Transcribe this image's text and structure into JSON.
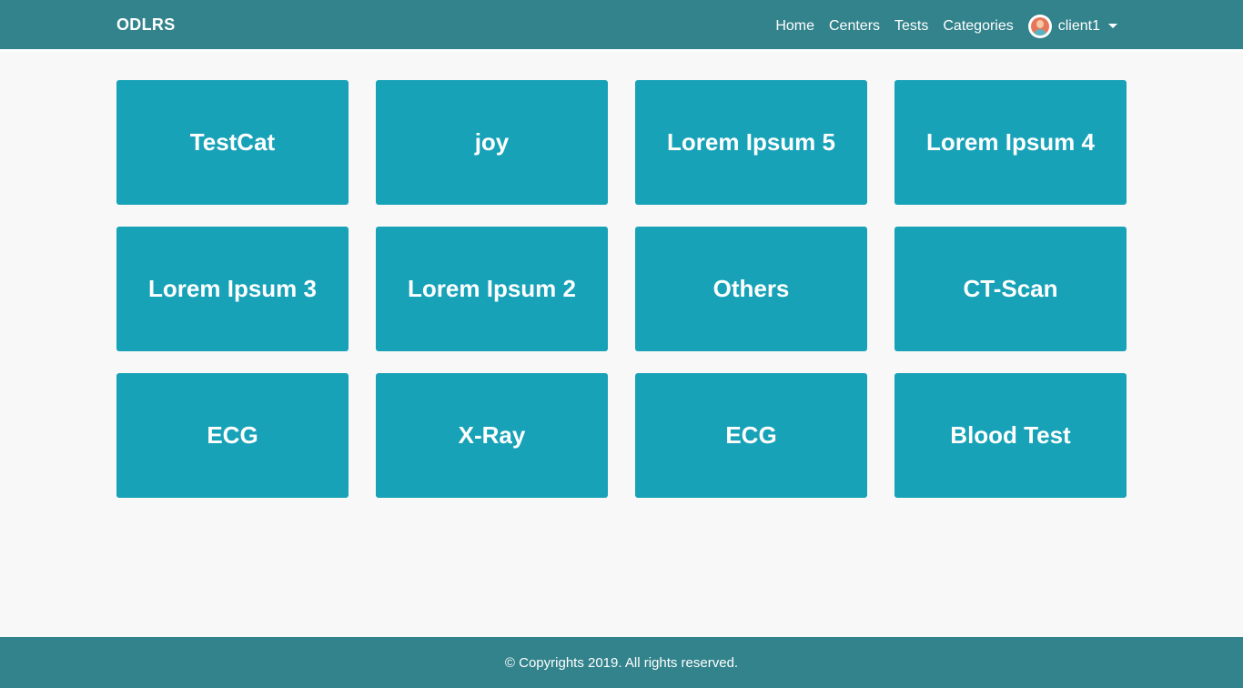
{
  "header": {
    "brand": "ODLRS",
    "nav": [
      "Home",
      "Centers",
      "Tests",
      "Categories"
    ],
    "user": {
      "name": "client1",
      "avatar_icon": "user-avatar-icon"
    }
  },
  "categories": [
    "TestCat",
    "joy",
    "Lorem Ipsum 5",
    "Lorem Ipsum 4",
    "Lorem Ipsum 3",
    "Lorem Ipsum 2",
    "Others",
    "CT-Scan",
    "ECG",
    "X-Ray",
    "ECG",
    "Blood Test"
  ],
  "footer": {
    "text": "© Copyrights 2019. All rights reserved."
  },
  "colors": {
    "header_bg": "#33838c",
    "card_bg": "#17a2b8",
    "page_bg": "#f8f8f8"
  }
}
